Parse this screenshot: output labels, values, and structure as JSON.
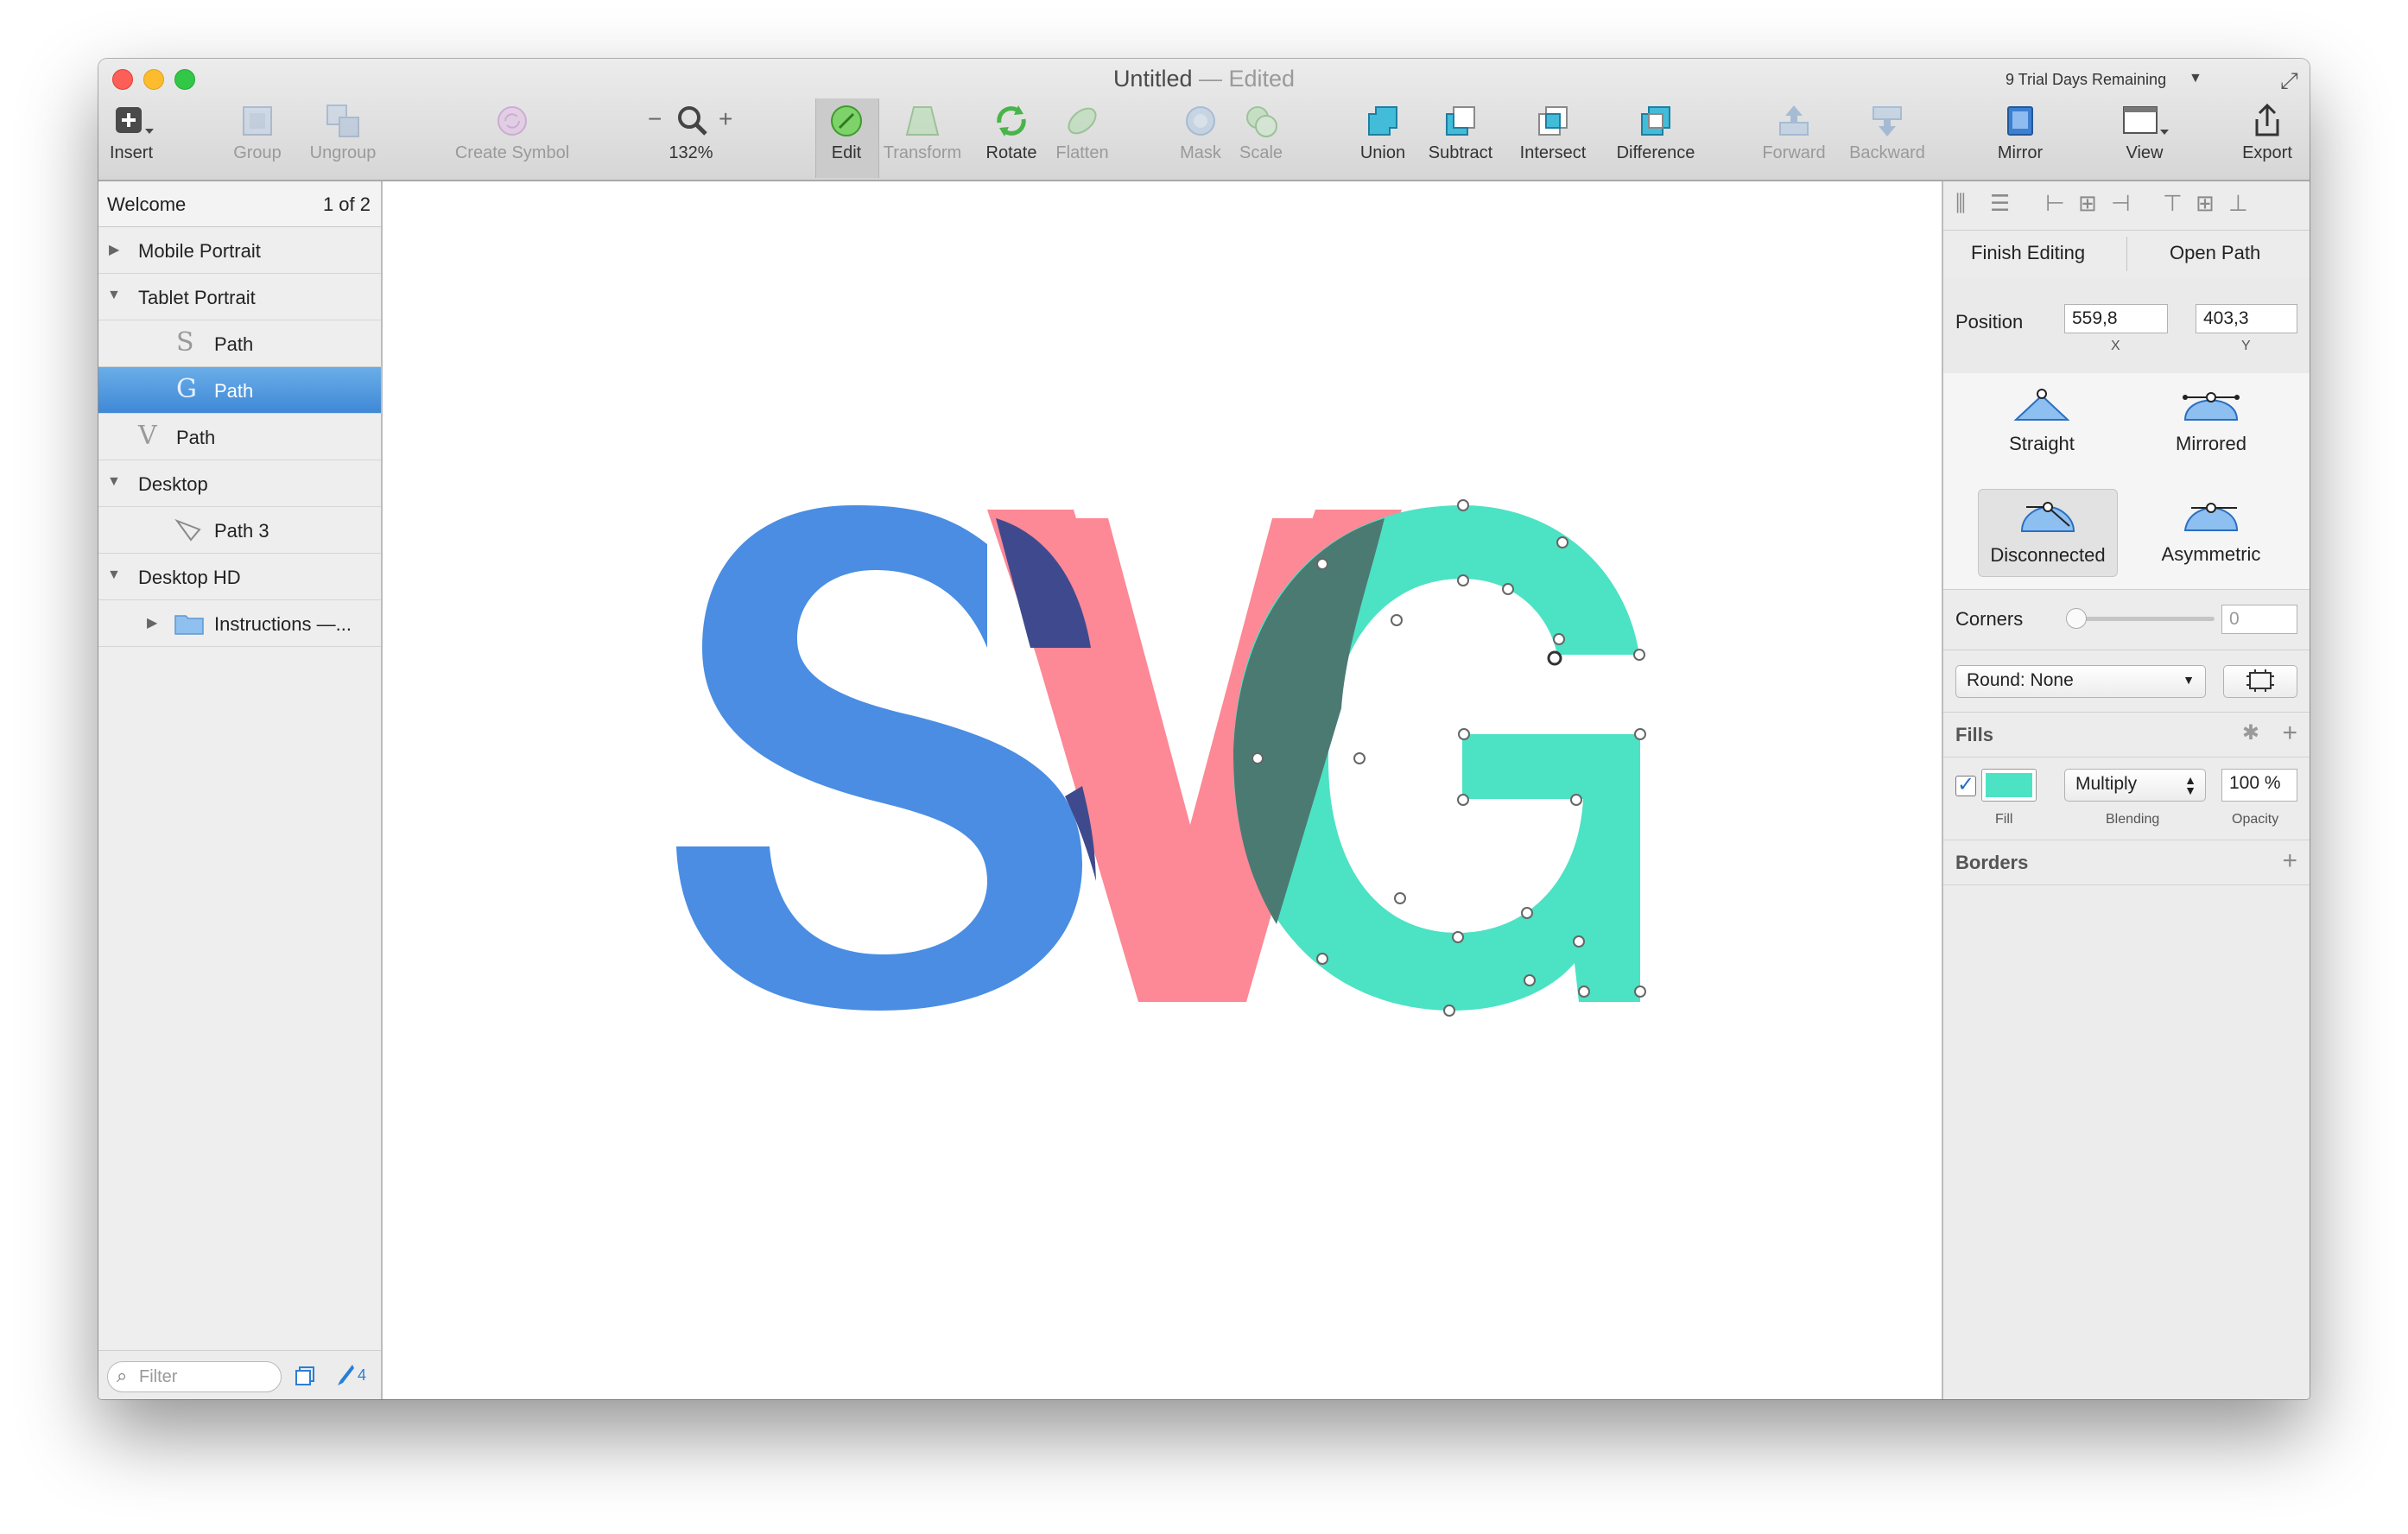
{
  "window": {
    "title": "Untitled",
    "status": "— Edited",
    "trial": "9 Trial Days Remaining"
  },
  "toolbar": {
    "insert": "Insert",
    "group": "Group",
    "ungroup": "Ungroup",
    "create_symbol": "Create Symbol",
    "zoom_minus": "−",
    "zoom_plus": "+",
    "zoom": "132%",
    "edit": "Edit",
    "transform": "Transform",
    "rotate": "Rotate",
    "flatten": "Flatten",
    "mask": "Mask",
    "scale": "Scale",
    "union": "Union",
    "subtract": "Subtract",
    "intersect": "Intersect",
    "difference": "Difference",
    "forward": "Forward",
    "backward": "Backward",
    "mirror": "Mirror",
    "view": "View",
    "export": "Export"
  },
  "sidebar": {
    "page_name": "Welcome",
    "page_count": "1 of 2",
    "layers": [
      {
        "label": "Mobile Portrait"
      },
      {
        "label": "Tablet Portrait"
      },
      {
        "label": "Path",
        "glyph": "S"
      },
      {
        "label": "Path",
        "glyph": "G"
      },
      {
        "label": "Path",
        "glyph": "V"
      },
      {
        "label": "Desktop"
      },
      {
        "label": "Path 3"
      },
      {
        "label": "Desktop HD"
      },
      {
        "label": "Instructions —..."
      }
    ],
    "filter_placeholder": "Filter",
    "edit_count": "4"
  },
  "canvas": {
    "letters": [
      "S",
      "V",
      "G"
    ],
    "colors": {
      "s": "#4a8de3",
      "v": "#fd8896",
      "g": "#4ce2c4",
      "overlap_sv": "#3f4a8e",
      "overlap_vg": "#4b7a73"
    }
  },
  "inspector": {
    "finish_editing": "Finish Editing",
    "open_path": "Open Path",
    "position_label": "Position",
    "x_value": "559,8",
    "y_value": "403,3",
    "x_label": "X",
    "y_label": "Y",
    "point_types": [
      "Straight",
      "Mirrored",
      "Disconnected",
      "Asymmetric"
    ],
    "corners_label": "Corners",
    "corners_value": "0",
    "round": "Round: None",
    "fills_title": "Fills",
    "fill_color": "#4ce2c4",
    "blending": "Multiply",
    "opacity": "100 %",
    "fill_label": "Fill",
    "blending_label": "Blending",
    "opacity_label": "Opacity",
    "borders_title": "Borders"
  }
}
